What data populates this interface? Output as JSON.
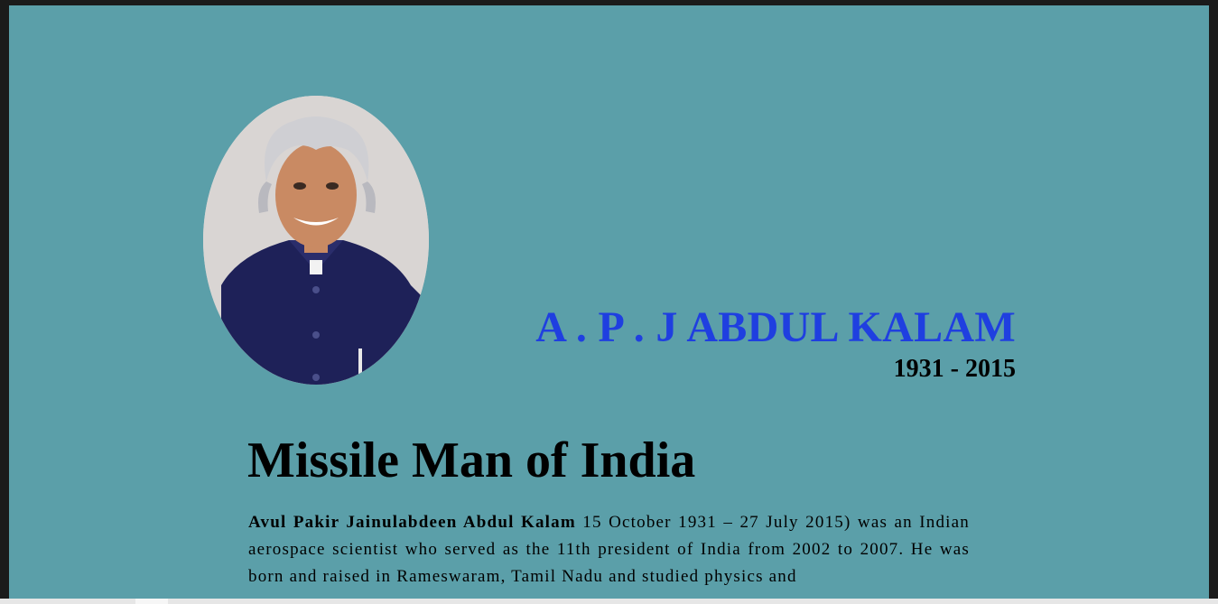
{
  "profile": {
    "name": "A . P . J ABDUL KALAM",
    "years": "1931 - 2015",
    "headline": "Missile Man of India",
    "bio_bold": "Avul Pakir Jainulabdeen Abdul Kalam",
    "bio_text": " 15 October 1931 – 27 July 2015) was an Indian aerospace scientist who served as the 11th president of India from 2002 to 2007. He was born and raised in Rameswaram, Tamil Nadu and studied physics and"
  },
  "colors": {
    "background": "#5b9fa9",
    "name": "#1f3fe0",
    "text": "#000000"
  }
}
